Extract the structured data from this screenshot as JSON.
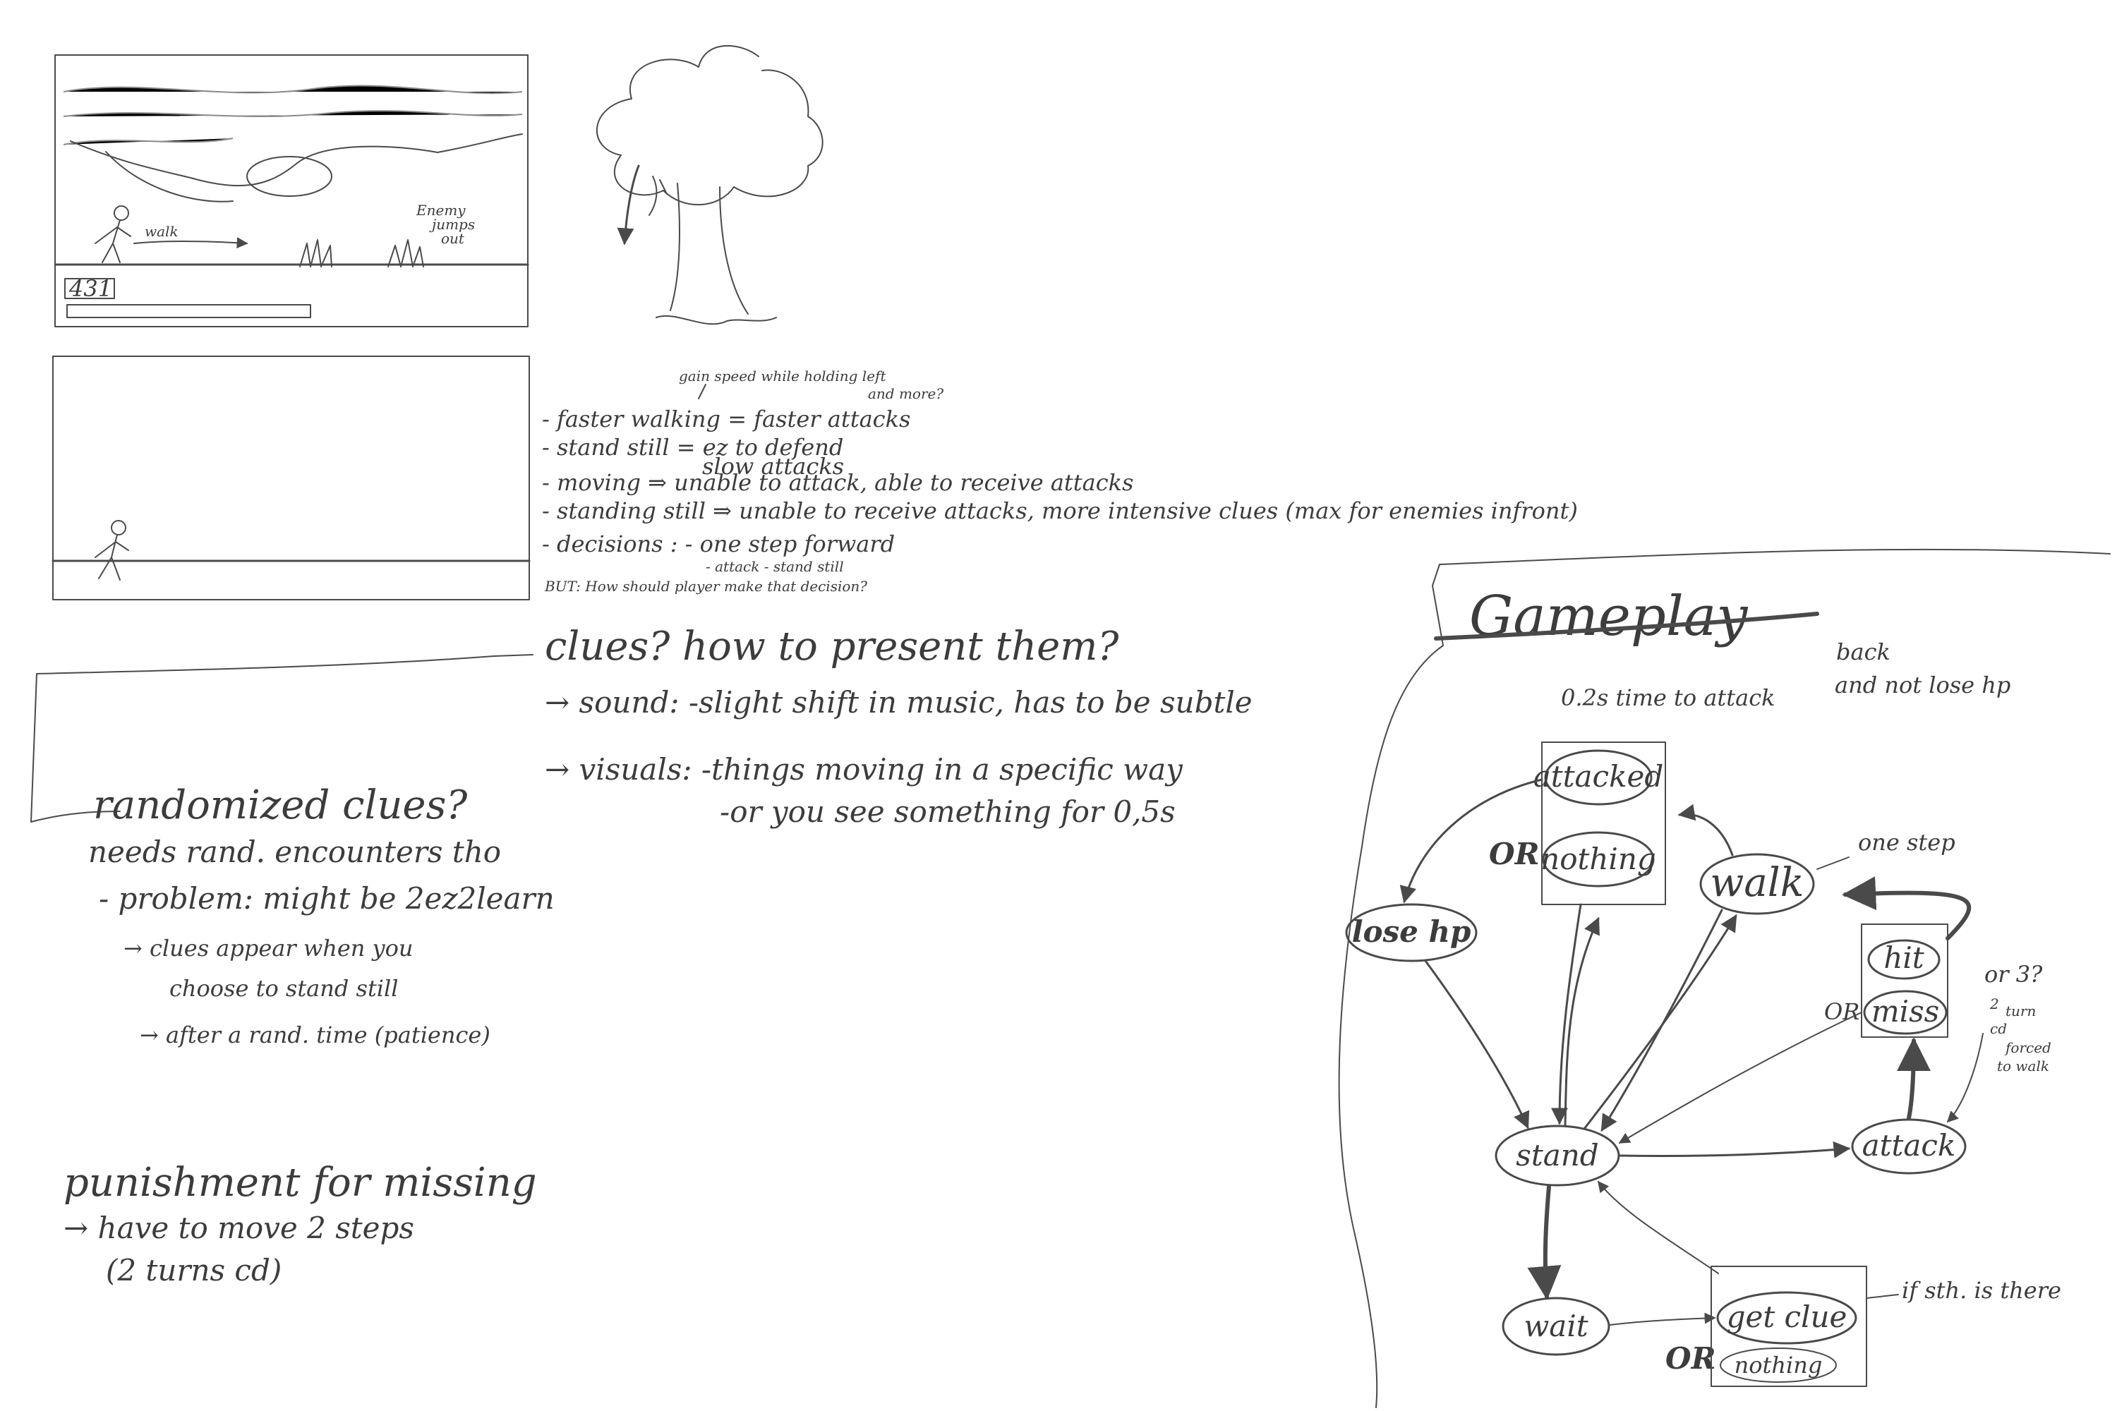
{
  "sketch_panels": {
    "hp_label": "431",
    "walk_label": "walk",
    "enemy_note": [
      "Enemy",
      "jumps",
      "out"
    ]
  },
  "mechanics_notes": {
    "speed_note": "gain speed while holding left",
    "and_more": "and more?",
    "faster_walking": "- faster walking = faster attacks",
    "stand_still": "- stand still    = ez to defend",
    "slow_attacks": "slow attacks",
    "moving": "- moving ⇒ unable to attack, able to receive attacks",
    "standing_still": "- standing still ⇒ unable to receive attacks, more intensive clues (max for enemies infront)",
    "decisions": "- decisions : - one step forward",
    "decisions_options": "- attack  - stand still",
    "but_question": "BUT: How should player make that decision?"
  },
  "clues_section": {
    "heading": "clues? how to present them?",
    "sound": "→ sound: -slight shift in music, has to be subtle",
    "visuals": "→ visuals: -things moving in a specific way",
    "visuals_2": "-or you see something for 0,5s"
  },
  "randomized_section": {
    "heading": "randomized clues?",
    "needs": "needs rand. encounters tho",
    "problem": "- problem: might be 2ez2learn",
    "appear_1": "→ clues appear when you",
    "appear_2": "choose to stand still",
    "after": "→ after a rand. time (patience)"
  },
  "punishment_section": {
    "heading": "punishment for missing",
    "move": "→ have to move 2 steps",
    "turns": "(2 turns cd)"
  },
  "gameplay": {
    "title": "Gameplay",
    "timing_note": "0.2s time to attack",
    "back_note": "back",
    "not_lose": "and not lose hp",
    "one_step": "one step",
    "or_3": "or 3?",
    "turn_cd": [
      "2",
      "turn",
      "cd"
    ],
    "forced": [
      "forced",
      "to walk"
    ],
    "if_sth": "if sth. is there",
    "or_label": "OR",
    "nodes": {
      "attacked": "attacked",
      "nothing_top": "nothing",
      "lose_hp": "lose hp",
      "walk": "walk",
      "hit": "hit",
      "miss": "miss",
      "stand": "stand",
      "attack": "attack",
      "wait": "wait",
      "get_clue": "get clue",
      "nothing_bottom": "nothing"
    }
  }
}
